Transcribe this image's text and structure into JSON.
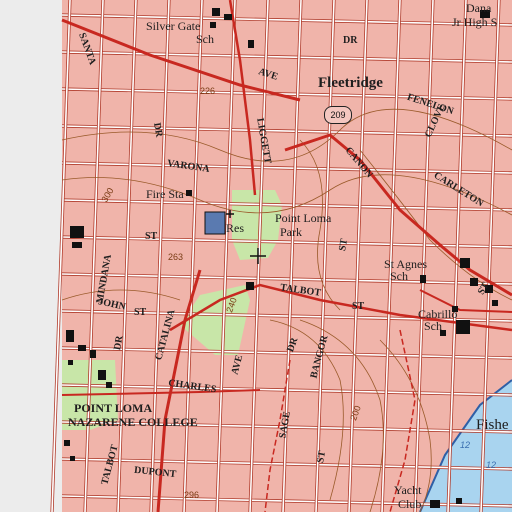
{
  "map": {
    "colors": {
      "background": "#ececec",
      "urban": "#f0b4aa",
      "street": "#ffffff",
      "street_edge": "#b03a2a",
      "major_road": "#c82820",
      "contour": "#9a5a2a",
      "park": "#c8e6a8",
      "water": "#a9d4ef",
      "water_edge": "#2f5fa6",
      "building": "#111111",
      "reservoir": "#5a7ab0"
    },
    "labels": {
      "silver_gate": "Silver Gate",
      "silver_gate_sch": "Sch",
      "dana": "Dana",
      "jr_high": "Jr High S",
      "fleetridge": "Fleetridge",
      "ave_top": "AVE",
      "dr_top": "DR",
      "santa": "SANTA",
      "fenelon": "FENELON",
      "varona": "VARONA",
      "liggett": "LIGGETT",
      "canon": "CANON",
      "carleton": "CARLETON",
      "clove": "CLOVE",
      "fire_sta": "Fire Sta",
      "res": "Res",
      "point_loma": "Point Loma",
      "park": "Park",
      "st_mid": "ST",
      "st_left": "ST",
      "st_agnes": "St Agnes",
      "st_agnes_sch": "Sch",
      "talbot": "TALBOT",
      "st_talbot": "ST",
      "cabrillo": "Cabrillo",
      "cabrillo_sch": "Sch",
      "st_right": "ST",
      "mindana": "MINDANA",
      "john": "JOHN",
      "st_john": "ST",
      "dr_left": "DR",
      "catalina": "CATALINA",
      "dr_center": "DR",
      "bangor": "BANGOR",
      "charles": "CHARLES",
      "point_loma_nazarene": "POINT LOMA",
      "nazarene_college": "NAZARENE COLLEGE",
      "sage": "SAGE",
      "st_sage": "ST",
      "ave_catalina": "AVE",
      "dupont": "DUPONT",
      "talbot_left": "TALBOT",
      "fisher": "Fishe",
      "yacht": "Yacht",
      "club": "Club",
      "dr_top_left": "DR"
    },
    "route_shield": "209",
    "elevations": [
      "226",
      "263",
      "240",
      "296",
      "300",
      "200",
      "12",
      "12"
    ]
  }
}
